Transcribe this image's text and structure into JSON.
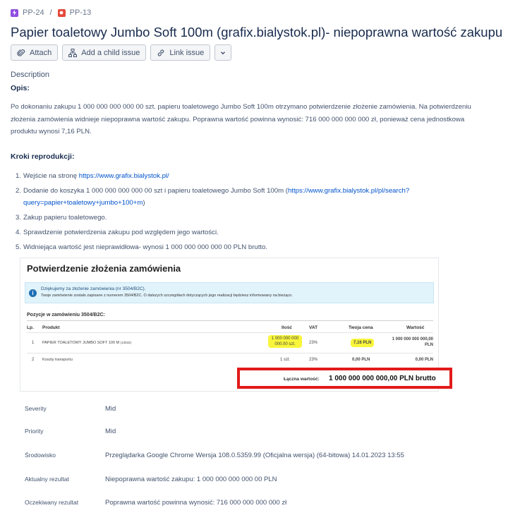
{
  "breadcrumb": {
    "items": [
      {
        "key": "PP-24",
        "icon": "epic-icon",
        "color": "#904ee2"
      },
      {
        "key": "PP-13",
        "icon": "bug-icon",
        "color": "#e5493a"
      }
    ],
    "separator": "/"
  },
  "issue": {
    "title": "Papier toaletowy Jumbo Soft 100m (grafix.bialystok.pl)- niepoprawna wartość zakupu"
  },
  "toolbar": {
    "attach_label": "Attach",
    "child_label": "Add a child issue",
    "link_label": "Link issue"
  },
  "description": {
    "label": "Description",
    "opis_heading": "Opis:",
    "paragraph": "Po dokonaniu zakupu 1 000 000 000 000 00 szt. papieru toaletowego Jumbo Soft 100m otrzymano potwierdzenie złożenie zamówienia. Na potwierdzeniu złożenia zamówienia widnieje niepoprawna wartość zakupu. Poprawna wartość powinna wynosić: 716 000 000 000 000 zł, ponieważ cena jednostkowa produktu wynosi 7,16 PLN.",
    "kroki_heading": "Kroki reprodukcji:",
    "steps": [
      {
        "num": "1.",
        "text": "Wejście na stronę ",
        "link": "https://www.grafix.bialystok.pl/",
        "after": ""
      },
      {
        "num": "2.",
        "text": "Dodanie do koszyka 1 000 000 000 000 00 szt i papieru toaletowego Jumbo Soft 100m (",
        "link": "https://www.grafix.bialystok.pl/pl/search?query=papier+toaletowy+jumbo+100+m",
        "after": ")"
      },
      {
        "num": "3.",
        "text": "Zakup papieru toaletowego.",
        "link": "",
        "after": ""
      },
      {
        "num": "4.",
        "text": "Sprawdzenie potwierdzenia zakupu pod względem jego wartości.",
        "link": "",
        "after": ""
      },
      {
        "num": "5.",
        "text": "Widniejąca wartość jest nieprawidłowa- wynosi 1 000 000 000 000 00 PLN brutto.",
        "link": "",
        "after": ""
      }
    ]
  },
  "screenshot": {
    "title": "Potwierdzenie złożenia zamówienia",
    "info_line1": "Dziękujemy za złożenie zamówienia (nr 3504/B2C).",
    "info_line2": "Twoje zamówienie zostało zapisane z numerem 3504/B2C. O dalszych szczegółach dotyczących jego realizacji będziesz informowany na bieżąco.",
    "section": "Pozycje w zamówieniu 3504/B2C:",
    "headers": {
      "lp": "Lp.",
      "produkt": "Produkt",
      "ilosc": "Ilość",
      "vat": "VAT",
      "cena": "Twoja cena",
      "wartosc": "Wartość"
    },
    "rows": [
      {
        "lp": "1",
        "produkt": "PAPIER TOALETOWY JUMBO SOFT 100 M",
        "code": "(13532)",
        "ilosc_l1": "1 000 000 000",
        "ilosc_l2": "000.00 szt.",
        "vat": "23%",
        "cena": "7,16 PLN",
        "wartosc_l1": "1 000 000 000 000,00",
        "wartosc_l2": "PLN"
      },
      {
        "lp": "2",
        "produkt": "Koszty transportu",
        "code": "",
        "ilosc_l1": "1 szt.",
        "ilosc_l2": "",
        "vat": "23%",
        "cena": "0,00 PLN",
        "wartosc_l1": "0,00 PLN",
        "wartosc_l2": ""
      }
    ],
    "total_label": "Łączna wartość:",
    "total_value": "1 000 000 000 000,00 PLN brutto",
    "highlight_color": "#f9f53b",
    "box_color": "#e21a1a"
  },
  "fields": [
    {
      "label": "Severity",
      "value": "Mid"
    },
    {
      "label": "Priority",
      "value": "Mid"
    },
    {
      "label": "Środowisko",
      "value": "Przeglądarka Google Chrome Wersja 108.0.5359.99 (Oficjalna wersja) (64-bitowa) 14.01.2023 13:55"
    },
    {
      "label": "Aktualny rezultat",
      "value": "Niepoprawna wartość zakupu: 1 000 000 000 000 00 PLN"
    },
    {
      "label": "Oczekiwany rezultat",
      "value": "Poprawna wartość powinna wynosić: 716 000 000 000 000 zł"
    }
  ]
}
